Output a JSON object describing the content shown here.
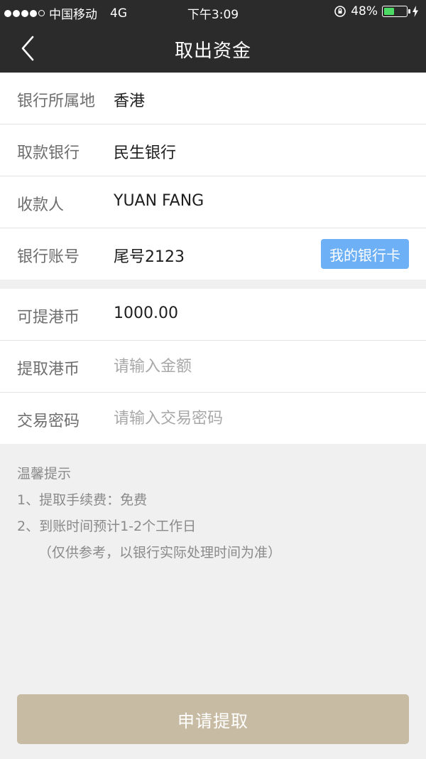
{
  "status_bar": {
    "carrier": "中国移动",
    "network": "4G",
    "time": "下午3:09",
    "battery": "48%",
    "battery_level": 0.48
  },
  "nav": {
    "title": "取出资金",
    "back_icon": "chevron-left-icon"
  },
  "bank_info": {
    "region_label": "银行所属地",
    "region_value": "香港",
    "bank_label": "取款银行",
    "bank_value": "民生银行",
    "payee_label": "收款人",
    "payee_value": "YUAN FANG",
    "account_label": "银行账号",
    "account_value": "尾号2123",
    "my_cards_button": "我的银行卡"
  },
  "withdraw": {
    "available_label": "可提港币",
    "available_value": "1000.00",
    "amount_label": "提取港币",
    "amount_placeholder": "请输入金额",
    "amount_value": "",
    "password_label": "交易密码",
    "password_placeholder": "请输入交易密码",
    "password_value": ""
  },
  "tips": {
    "title": "温馨提示",
    "line1": "1、提取手续费：免费",
    "line2": "2、到账时间预计1-2个工作日",
    "line3": "（仅供参考，以银行实际处理时间为准）"
  },
  "submit_button": "申请提取",
  "colors": {
    "header_bg": "#2b2b2b",
    "accent_blue": "#6eb0f5",
    "submit_bg": "#c8bba4",
    "battery_green": "#4cd964"
  }
}
